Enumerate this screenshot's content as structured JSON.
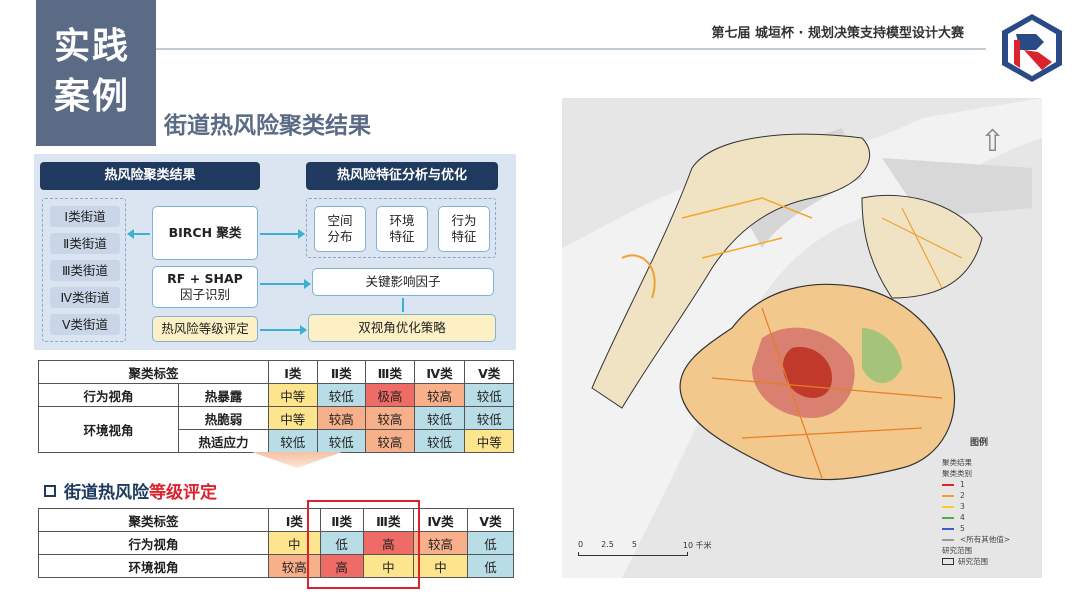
{
  "header": {
    "tag_line1": "实践",
    "tag_line2": "案例",
    "contest": "第七届 城垣杯 · 规划决策支持模型设计大赛",
    "page_title": "街道热风险聚类结果"
  },
  "flow": {
    "left_header": "热风险聚类结果",
    "right_header": "热风险特征分析与优化",
    "classes": [
      "Ⅰ类街道",
      "Ⅱ类街道",
      "Ⅲ类街道",
      "Ⅳ类街道",
      "Ⅴ类街道"
    ],
    "birch": "BIRCH 聚类",
    "rf_line1": "RF + SHAP",
    "rf_line2": "因子识别",
    "rating": "热风险等级评定",
    "feat1": "空间\n分布",
    "feat2": "环境\n特征",
    "feat3": "行为\n特征",
    "key_factors": "关键影响因子",
    "strategy": "双视角优化策略"
  },
  "table1": {
    "header": [
      "聚类标签",
      "Ⅰ类",
      "Ⅱ类",
      "Ⅲ类",
      "Ⅳ类",
      "Ⅴ类"
    ],
    "rows": [
      {
        "view": "行为视角",
        "factor": "热暴露",
        "values": [
          "中等",
          "较低",
          "极高",
          "较高",
          "较低"
        ]
      },
      {
        "view": "环境视角",
        "factor": "热脆弱",
        "values": [
          "中等",
          "较高",
          "较高",
          "较低",
          "较低"
        ]
      },
      {
        "view": "",
        "factor": "热适应力",
        "values": [
          "较低",
          "较低",
          "较高",
          "较低",
          "中等"
        ]
      }
    ]
  },
  "rating_section": {
    "title_prefix": "街道热风险",
    "title_red": "等级评定"
  },
  "table2": {
    "header": [
      "聚类标签",
      "Ⅰ类",
      "Ⅱ类",
      "Ⅲ类",
      "Ⅳ类",
      "Ⅴ类"
    ],
    "rows": [
      {
        "view": "行为视角",
        "values": [
          "中",
          "低",
          "高",
          "较高",
          "低"
        ]
      },
      {
        "view": "环境视角",
        "values": [
          "较高",
          "高",
          "中",
          "中",
          "低"
        ]
      }
    ]
  },
  "map": {
    "legend_title": "图例",
    "legend_sub1": "聚类结果",
    "legend_sub2": "聚类类别",
    "legend_items": [
      "1",
      "2",
      "3",
      "4",
      "5",
      "<所有其他值>"
    ],
    "legend_colors": [
      "#d9232d",
      "#f0a030",
      "#f5d020",
      "#4caf50",
      "#3a5fcd",
      "#999999"
    ],
    "boundary_label": "研究范围",
    "boundary_item": "研究范围",
    "scale_ticks": [
      "0",
      "2.5",
      "5",
      "10 千米"
    ]
  },
  "colors": {
    "mid": "#fde58d",
    "low": "#b8dde6",
    "high": "#f7b08a",
    "xhigh": "#ee6b66",
    "navy": "#1f3a5e",
    "accent_red": "#d9232d"
  }
}
